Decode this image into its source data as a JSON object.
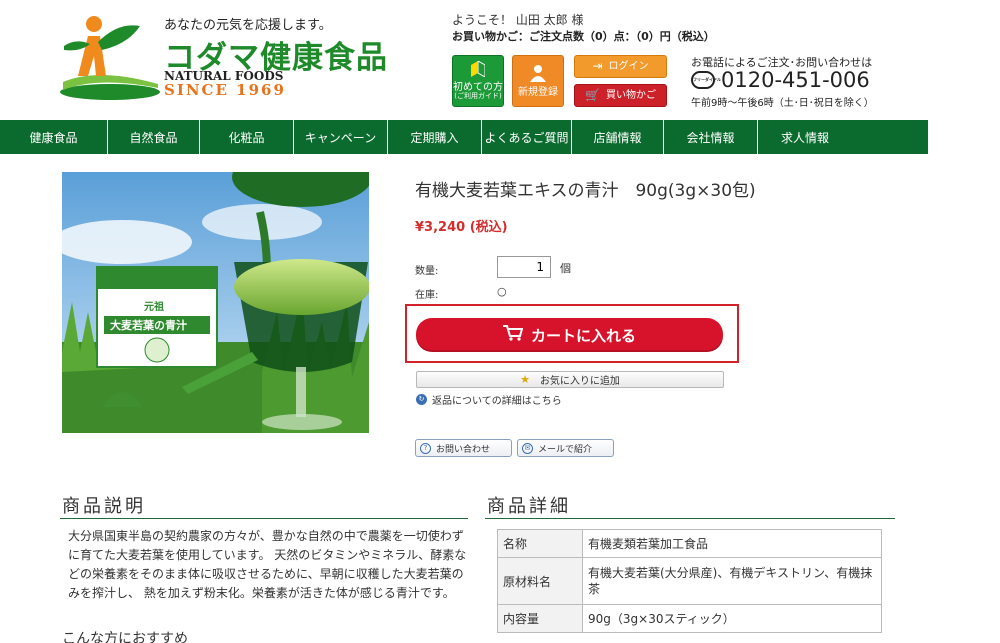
{
  "header": {
    "tagline": "あなたの元気を応援します。",
    "brand_name": "コダマ健康食品",
    "natural_foods": "NATURAL FOODS",
    "since": "SINCE 1969",
    "welcome": "ようこそ！ 山田 太郎 様",
    "cart_summary": "お買い物かご：ご注文点数（0）点：（0）円（税込）",
    "btn_first_line1": "初めての方",
    "btn_first_line2": "(ご利用ガイド)",
    "btn_register": "新規登録",
    "btn_login": "ログイン",
    "btn_cart": "買い物かご",
    "phone_note": "お電話によるご注文･お問い合わせは",
    "phone_badge": "フリーダイヤル",
    "phone_number": "0120-451-006",
    "hours": "午前9時～午後6時（土･日･祝日を除く）"
  },
  "nav": {
    "items": [
      "健康食品",
      "自然食品",
      "化粧品",
      "キャンペーン",
      "定期購入",
      "よくあるご質問",
      "店舗情報",
      "会社情報",
      "求人情報"
    ]
  },
  "product": {
    "title": "有機大麦若葉エキスの青汁　90g(3g×30包)",
    "price": "¥3,240 (税込)",
    "qty_label": "数量:",
    "qty_value": "1",
    "qty_unit": "個",
    "stock_label": "在庫:",
    "stock_value": "○",
    "add_to_cart": "カートに入れる",
    "add_favorite": "お気に入りに追加",
    "return_info": "返品についての詳細はこちら",
    "contact_btn": "お問い合わせ",
    "mail_btn": "メールで紹介",
    "package_text": "大麦若葉の青汁",
    "package_brand": "元祖"
  },
  "description": {
    "title": "商品説明",
    "body": "大分県国東半島の契約農家の方々が、豊かな自然の中で農薬を一切使わずに育てた大麦若葉を使用しています。 天然のビタミンやミネラル、酵素などの栄養素をそのまま体に吸収させるために、早朝に収穫した大麦若葉のみを搾汁し、 熱を加えず粉末化。栄養素が活きた体が感じる青汁です。",
    "recommend_title": "こんな方におすすめ"
  },
  "details": {
    "title": "商品詳細",
    "rows": [
      {
        "key": "名称",
        "value": "有機麦類若葉加工食品"
      },
      {
        "key": "原材料名",
        "value": "有機大麦若葉(大分県産)、有機デキストリン、有機抹茶"
      },
      {
        "key": "内容量",
        "value": "90g（3g×30スティック）"
      }
    ]
  },
  "colors": {
    "nav_green": "#0b6b2e",
    "brand_green": "#1e8a2a",
    "price_red": "#d42d2d",
    "cart_red": "#d6132b"
  }
}
